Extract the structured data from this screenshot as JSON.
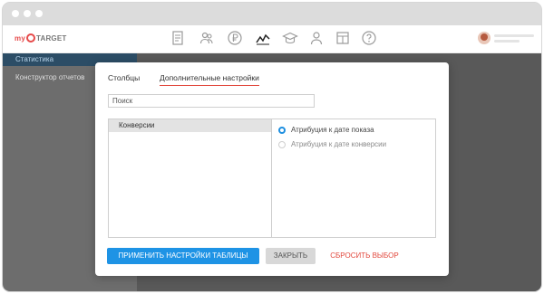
{
  "header": {
    "logo": {
      "part1": "my",
      "part2": "TARGET"
    },
    "nav_icons": [
      "report-icon",
      "users-icon",
      "ruble-icon",
      "statistics-icon",
      "education-icon",
      "user-icon",
      "layout-icon",
      "help-icon"
    ],
    "active_icon": "statistics-icon"
  },
  "sidebar": {
    "items": [
      {
        "label": "Статистика",
        "active": true
      },
      {
        "label": "Конструктор отчетов",
        "active": false
      }
    ]
  },
  "modal": {
    "tabs": [
      {
        "label": "Столбцы",
        "active": false
      },
      {
        "label": "Дополнительные настройки",
        "active": true
      }
    ],
    "search": {
      "placeholder": "Поиск"
    },
    "list": {
      "items": [
        "Конверсии"
      ]
    },
    "attribution": {
      "options": [
        {
          "label": "Атрибуция к дате показа",
          "selected": true
        },
        {
          "label": "Атрибуция к дате конверсии",
          "selected": false
        }
      ]
    },
    "buttons": {
      "apply": "ПРИМЕНИТЬ НАСТРОЙКИ ТАБЛИЦЫ",
      "close": "ЗАКРЫТЬ",
      "reset": "СБРОСИТЬ ВЫБОР"
    }
  },
  "colors": {
    "accent": "#1e93e5",
    "danger": "#e2483d",
    "sidebar_active": "#2c4d66"
  }
}
